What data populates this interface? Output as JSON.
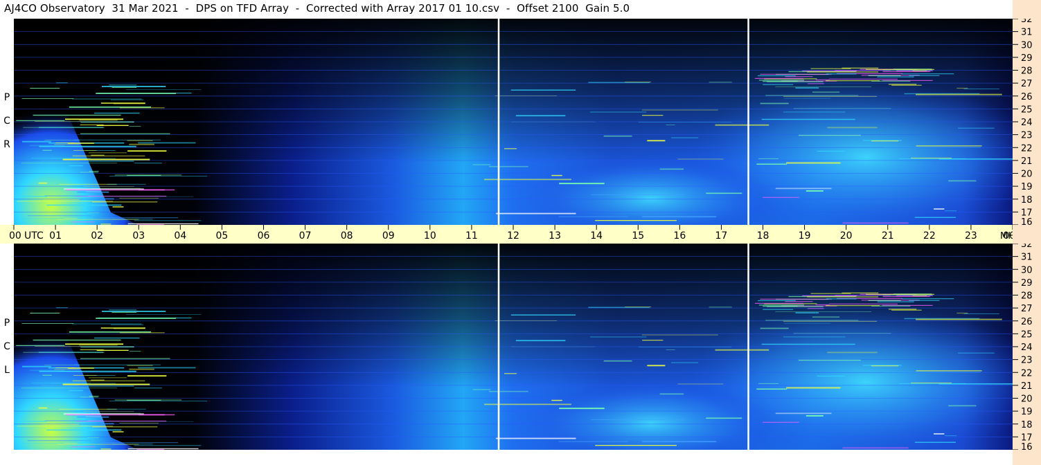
{
  "title": "AJ4CO Observatory  31 Mar 2021  -  DPS on TFD Array  -  Corrected with Array 2017 01 10.csv  -  Offset 2100  Gain 5.0",
  "panels": [
    {
      "id": "rcp",
      "label_letters": [
        "R",
        "C",
        "P"
      ]
    },
    {
      "id": "lcp",
      "label_letters": [
        "L",
        "C",
        "P"
      ]
    }
  ],
  "time_axis": {
    "ticks": [
      "00",
      "01",
      "02",
      "03",
      "04",
      "05",
      "06",
      "07",
      "08",
      "09",
      "10",
      "11",
      "12",
      "13",
      "14",
      "15",
      "16",
      "17",
      "18",
      "19",
      "20",
      "21",
      "22",
      "23",
      "00"
    ],
    "utc_label": "UTC",
    "mhz_label": "MHz"
  },
  "chart_data": [
    {
      "type": "heatmap",
      "title": "AJ4CO Observatory  31 Mar 2021  -  DPS on TFD Array  -  Corrected with Array 2017 01 10.csv  -  Offset 2100  Gain 5.0",
      "panel": "R C P",
      "x_range_utc_hours": [
        0,
        24
      ],
      "y_range_mhz": [
        16,
        32
      ],
      "y_ticks": [
        16,
        17,
        18,
        19,
        20,
        21,
        22,
        23,
        24,
        25,
        26,
        27,
        28,
        29,
        30,
        31,
        32
      ],
      "xlabel": "UTC",
      "ylabel": "MHz",
      "vertical_markers_utc_hours": [
        11.65,
        17.65
      ],
      "colormap": [
        "#000000",
        "#0a1a8c",
        "#1a4ae8",
        "#25b8ff",
        "#7affb0",
        "#f0ff40",
        "#ff40ff",
        "#ffffff"
      ]
    },
    {
      "type": "heatmap",
      "title": "AJ4CO Observatory  31 Mar 2021  -  DPS on TFD Array  -  Corrected with Array 2017 01 10.csv  -  Offset 2100  Gain 5.0",
      "panel": "L C P",
      "x_range_utc_hours": [
        0,
        24
      ],
      "y_range_mhz": [
        16,
        32
      ],
      "y_ticks": [
        16,
        17,
        18,
        19,
        20,
        21,
        22,
        23,
        24,
        25,
        26,
        27,
        28,
        29,
        30,
        31,
        32
      ],
      "xlabel": "UTC",
      "ylabel": "MHz",
      "vertical_markers_utc_hours": [
        11.65,
        17.65
      ],
      "colormap": [
        "#000000",
        "#0a1a8c",
        "#1a4ae8",
        "#25b8ff",
        "#7affb0",
        "#f0ff40",
        "#ff40ff",
        "#ffffff"
      ]
    }
  ]
}
